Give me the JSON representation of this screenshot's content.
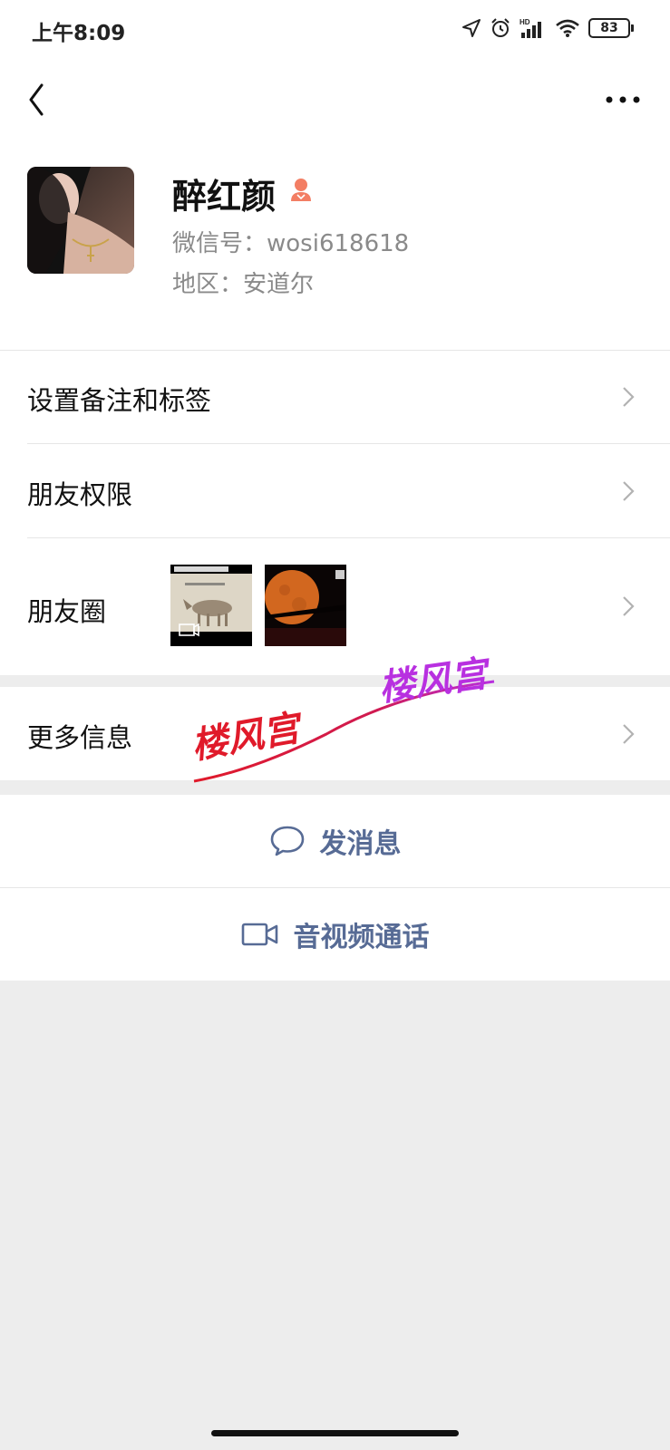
{
  "status_bar": {
    "time": "上午8:09",
    "battery": "83",
    "icons": [
      "location-icon",
      "alarm-icon",
      "hd-signal-icon",
      "wifi-icon",
      "battery-icon"
    ]
  },
  "header": {
    "back_icon": "chevron-left-icon",
    "more_icon": "more-dots-icon"
  },
  "profile": {
    "name": "醉红颜",
    "wechat_id": "微信号：wosi618618",
    "region": "地区：安道尔",
    "gender_icon": "female-icon",
    "gender_color": "#f37e64"
  },
  "menu": {
    "remark": "设置备注和标签",
    "permission": "朋友权限",
    "moments": "朋友圈",
    "more_info": "更多信息"
  },
  "moments_thumbs": [
    "donkey-meme-video-thumbnail",
    "orange-moon-thumbnail"
  ],
  "actions": {
    "message": "发消息",
    "call": "音视频通话"
  },
  "watermark": {
    "text_left": "楼风宫",
    "text_right": "楼风宫",
    "color_left": "#e01a2a",
    "color_right": "#b830e0"
  },
  "colors": {
    "link_blue": "#576b95",
    "background": "#ededed"
  }
}
